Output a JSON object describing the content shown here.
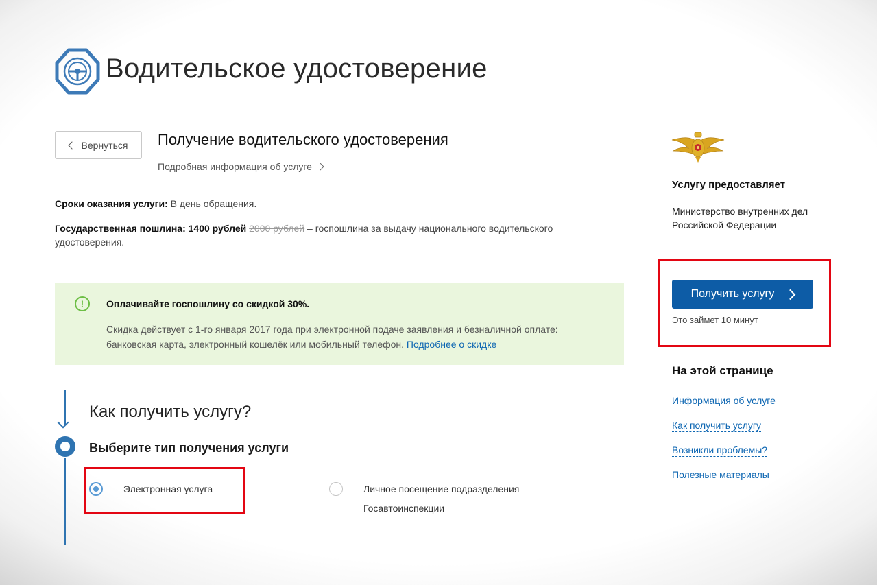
{
  "header": {
    "title": "Водительское удостоверение"
  },
  "back_button": {
    "label": "Вернуться"
  },
  "service": {
    "title": "Получение водительского удостоверения",
    "more_info_link": "Подробная информация об услуге"
  },
  "terms": {
    "label": "Сроки оказания услуги:",
    "value": " В день обращения."
  },
  "fee": {
    "label": "Государственная пошлина:",
    "price": " 1400 рублей ",
    "old_price": "2000 рублей",
    "description": " – госпошлина за выдачу национального водительского удостоверения."
  },
  "notice": {
    "icon": "exclamation-icon",
    "title": "Оплачивайте госпошлину со скидкой 30%.",
    "body": "Скидка действует с 1-го января 2017 года при электронной подаче заявления и безналичной оплате: банковская карта, электронный кошелёк или мобильный телефон. ",
    "link": "Подробнее о скидке",
    "colors": {
      "background": "#eaf6dd",
      "icon": "#6dbe45"
    }
  },
  "how": {
    "title": "Как получить услугу?",
    "step_title": "Выберите тип получения услуги",
    "options": [
      {
        "label": "Электронная услуга",
        "selected": true
      },
      {
        "label": "Личное посещение подразделения Госавтоинспекции",
        "selected": false
      }
    ]
  },
  "provider": {
    "emblem": "mvd-eagle-emblem",
    "heading": "Услугу предоставляет",
    "name": "Министерство внутренних дел Российской Федерации"
  },
  "get_service": {
    "button": "Получить услугу",
    "time_note": "Это займет 10 минут",
    "color": "#0d5ca6"
  },
  "toc": {
    "heading": "На этой странице",
    "links": [
      "Информация об услуге",
      "Как получить услугу",
      "Возникли проблемы?",
      "Полезные материалы"
    ]
  },
  "highlight_color": "#e30613"
}
